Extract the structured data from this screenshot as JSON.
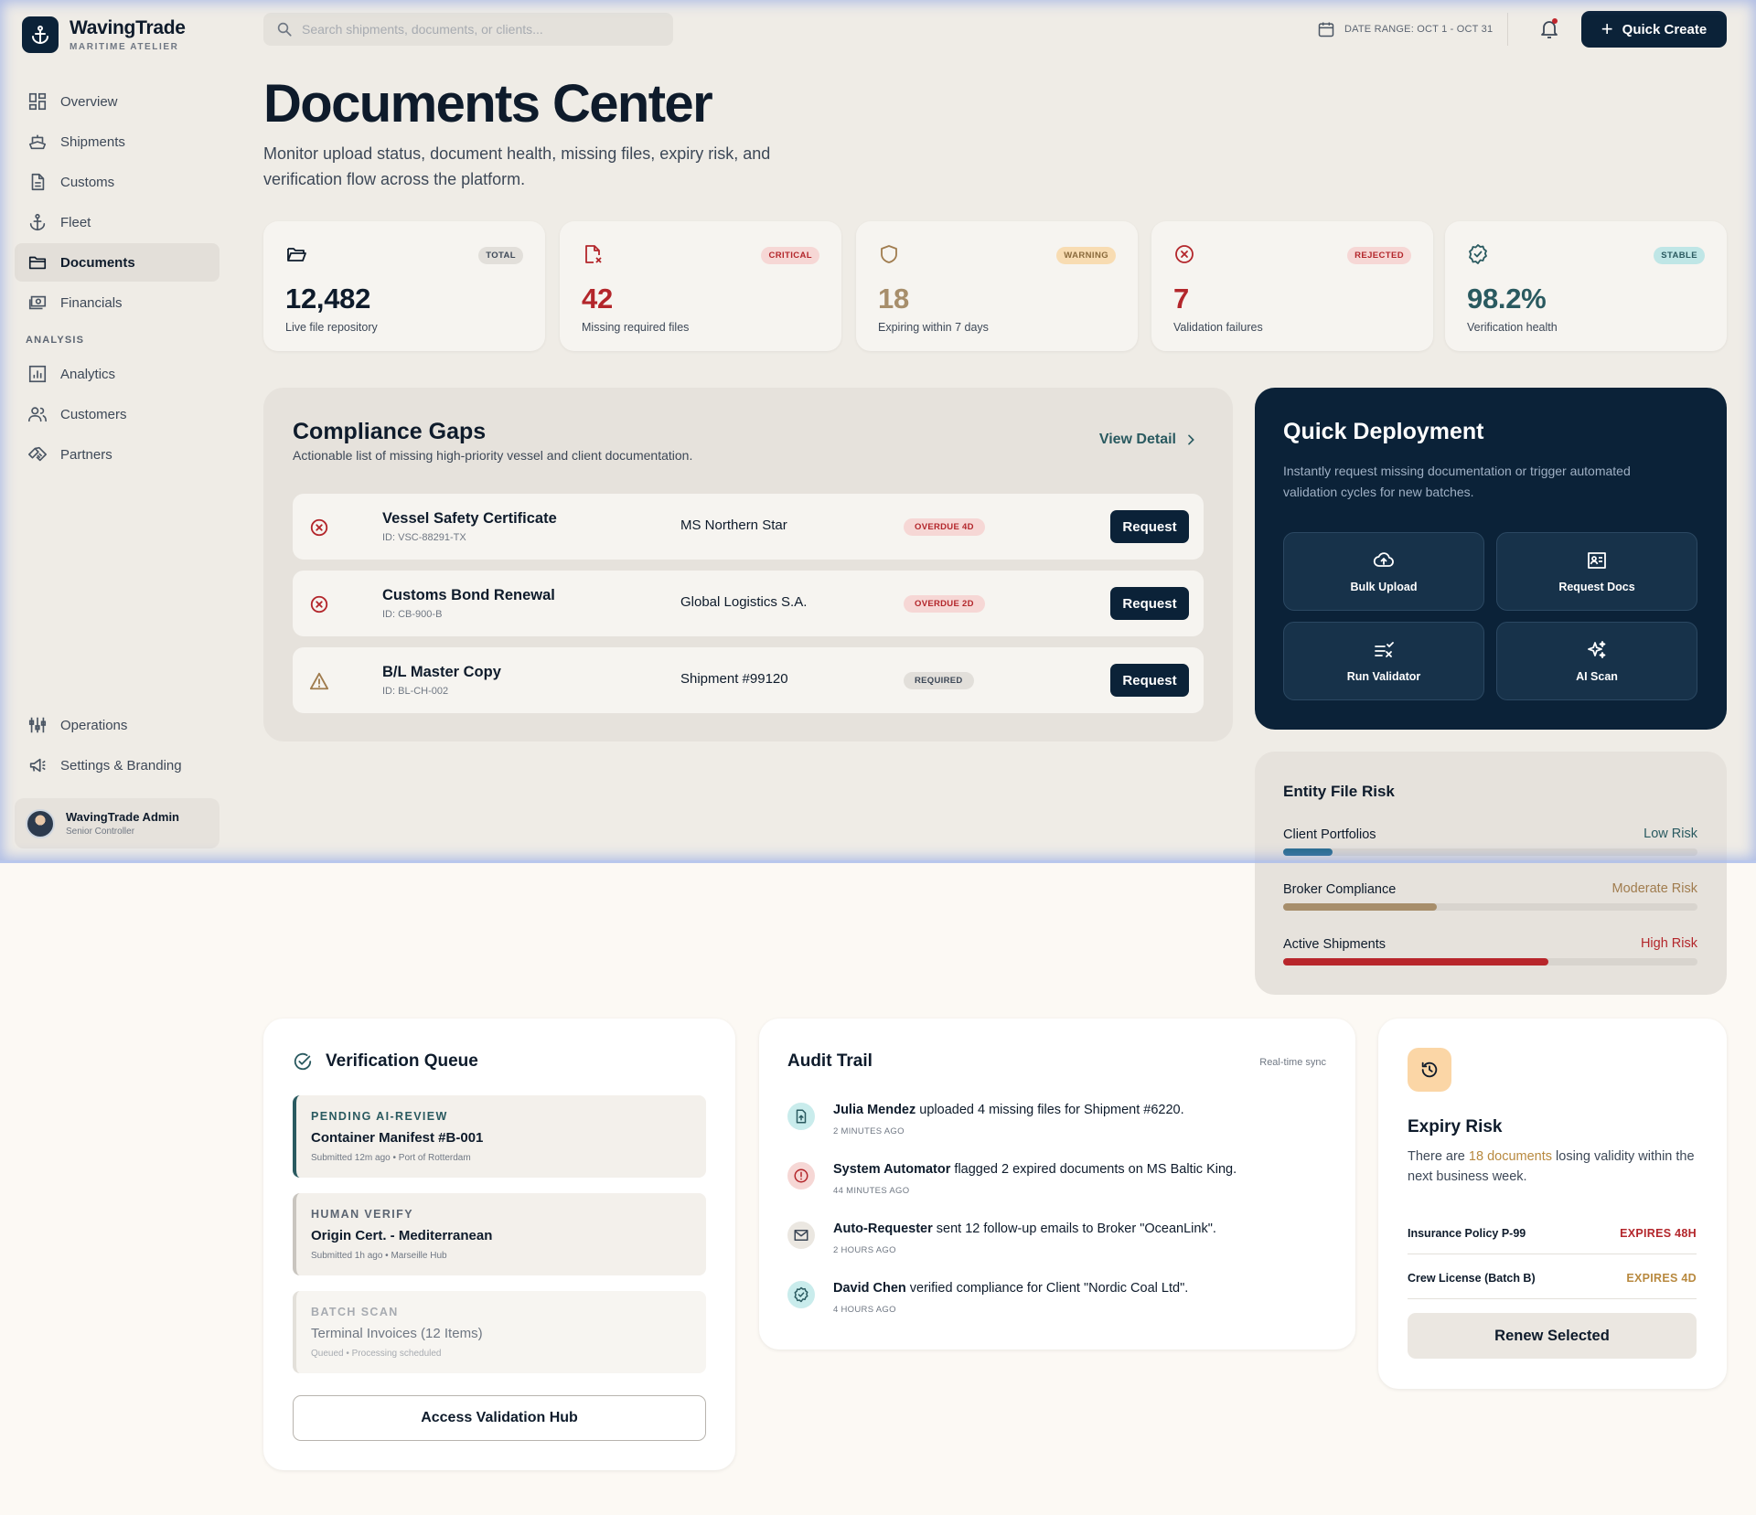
{
  "brand": {
    "name": "WavingTrade",
    "subtitle": "MARITIME ATELIER"
  },
  "sidebar": {
    "items": [
      {
        "label": "Overview",
        "icon": "grid-icon"
      },
      {
        "label": "Shipments",
        "icon": "ship-icon"
      },
      {
        "label": "Customs",
        "icon": "document-icon"
      },
      {
        "label": "Fleet",
        "icon": "anchor-icon"
      },
      {
        "label": "Documents",
        "icon": "folder-icon",
        "active": true
      },
      {
        "label": "Financials",
        "icon": "money-icon"
      }
    ],
    "section_label": "ANALYSIS",
    "analysis_items": [
      {
        "label": "Analytics",
        "icon": "chart-icon"
      },
      {
        "label": "Customers",
        "icon": "users-icon"
      },
      {
        "label": "Partners",
        "icon": "handshake-icon"
      }
    ],
    "bottom_items": [
      {
        "label": "Operations",
        "icon": "sliders-icon"
      },
      {
        "label": "Settings & Branding",
        "icon": "megaphone-icon"
      }
    ],
    "user": {
      "name": "WavingTrade Admin",
      "role": "Senior Controller"
    }
  },
  "topbar": {
    "search_placeholder": "Search shipments, documents, or clients...",
    "date_range": "DATE RANGE: OCT 1 - OCT 31",
    "quick_create": "Quick Create"
  },
  "header": {
    "title": "Documents Center",
    "description": "Monitor upload status, document health, missing files, expiry risk, and verification flow across the platform."
  },
  "stats": [
    {
      "badge": "TOTAL",
      "value": "12,482",
      "label": "Live file repository",
      "icon": "folder-open-icon"
    },
    {
      "badge": "CRITICAL",
      "value": "42",
      "label": "Missing required files",
      "icon": "file-missing-icon"
    },
    {
      "badge": "WARNING",
      "value": "18",
      "label": "Expiring within 7 days",
      "icon": "shield-icon"
    },
    {
      "badge": "REJECTED",
      "value": "7",
      "label": "Validation failures",
      "icon": "error-circle-icon"
    },
    {
      "badge": "STABLE",
      "value": "98.2%",
      "label": "Verification health",
      "icon": "verified-icon"
    }
  ],
  "compliance": {
    "title": "Compliance Gaps",
    "subtitle": "Actionable list of missing high-priority vessel and client documentation.",
    "view_detail": "View Detail",
    "rows": [
      {
        "name": "Vessel Safety Certificate",
        "id": "ID: VSC-88291-TX",
        "entity": "MS Northern Star",
        "status": "OVERDUE 4D",
        "action": "Request"
      },
      {
        "name": "Customs Bond Renewal",
        "id": "ID: CB-900-B",
        "entity": "Global Logistics S.A.",
        "status": "OVERDUE 2D",
        "action": "Request"
      },
      {
        "name": "B/L Master Copy",
        "id": "ID: BL-CH-002",
        "entity": "Shipment #99120",
        "status": "REQUIRED",
        "action": "Request"
      }
    ]
  },
  "deployment": {
    "title": "Quick Deployment",
    "description": "Instantly request missing documentation or trigger automated validation cycles for new batches.",
    "actions": [
      {
        "label": "Bulk Upload",
        "icon": "cloud-upload-icon"
      },
      {
        "label": "Request Docs",
        "icon": "id-card-icon"
      },
      {
        "label": "Run Validator",
        "icon": "validator-icon"
      },
      {
        "label": "AI Scan",
        "icon": "sparkles-icon"
      }
    ]
  },
  "entity_risk": {
    "title": "Entity File Risk",
    "rows": [
      {
        "name": "Client Portfolios",
        "level": "Low Risk",
        "value": 0.12,
        "color": "#2b6d8f",
        "text_color": "#2a5a60"
      },
      {
        "name": "Broker Compliance",
        "level": "Moderate Risk",
        "value": 0.37,
        "color": "#a78e6b",
        "text_color": "#a07c4e"
      },
      {
        "name": "Active Shipments",
        "level": "High Risk",
        "value": 0.64,
        "color": "#b8262b",
        "text_color": "#b3262b"
      }
    ]
  },
  "verification_queue": {
    "title": "Verification Queue",
    "items": [
      {
        "tag": "PENDING AI-REVIEW",
        "name": "Container Manifest #B-001",
        "meta": "Submitted 12m ago • Port of Rotterdam"
      },
      {
        "tag": "HUMAN VERIFY",
        "name": "Origin Cert. - Mediterranean",
        "meta": "Submitted 1h ago • Marseille Hub"
      },
      {
        "tag": "BATCH SCAN",
        "name": "Terminal Invoices (12 Items)",
        "meta": "Queued • Processing scheduled"
      }
    ],
    "button": "Access Validation Hub"
  },
  "audit": {
    "title": "Audit Trail",
    "sync": "Real-time sync",
    "events": [
      {
        "actor": "Julia Mendez",
        "text": " uploaded 4 missing files for Shipment #6220.",
        "time": "2 MINUTES AGO",
        "icon": "upload-file-icon"
      },
      {
        "actor": "System Automator",
        "text": " flagged 2 expired documents on MS Baltic King.",
        "time": "44 MINUTES AGO",
        "icon": "alert-icon"
      },
      {
        "actor": "Auto-Requester",
        "text": " sent 12 follow-up emails to Broker \"OceanLink\".",
        "time": "2 HOURS AGO",
        "icon": "mail-icon"
      },
      {
        "actor": "David Chen",
        "text": " verified compliance for Client \"Nordic Coal Ltd\".",
        "time": "4 HOURS AGO",
        "icon": "verified-icon"
      }
    ]
  },
  "expiry": {
    "title": "Expiry Risk",
    "desc_before": "There are ",
    "desc_highlight": "18 documents",
    "desc_after": " losing validity within the next business week.",
    "rows": [
      {
        "name": "Insurance Policy P-99",
        "status": "EXPIRES 48H",
        "color": "#b3262b"
      },
      {
        "name": "Crew License (Batch B)",
        "status": "EXPIRES 4D",
        "color": "#b8893f"
      }
    ],
    "button": "Renew Selected"
  }
}
